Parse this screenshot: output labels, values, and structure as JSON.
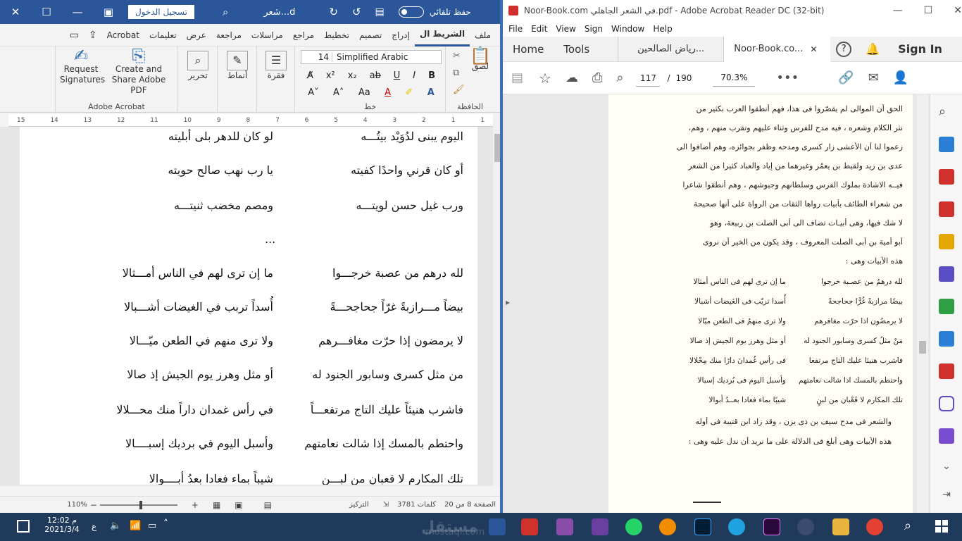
{
  "word": {
    "autosave_label": "حفظ تلقائي",
    "doc_name": "شعر...d",
    "signin_label": "تسجيل الدخول",
    "tabs": [
      "ملف",
      "الشريط ال",
      "إدراج",
      "تصميم",
      "تخطيط",
      "مراجع",
      "مراسلات",
      "مراجعة",
      "عرض",
      "تعليمات",
      "Acrobat"
    ],
    "groups": {
      "clipboard": "الحافظة",
      "paste": "لصق",
      "font": "خط",
      "paragraph": "فقرة",
      "styles": "أنماط",
      "editing": "تحرير",
      "acrobat_group": "Adobe Acrobat",
      "request_sigs": "Request Signatures",
      "create_share": "Create and Share Adobe PDF"
    },
    "font_name": "Simplified Arabic",
    "font_size": "14",
    "ruler_labels": [
      "15",
      "14",
      "13",
      "12",
      "11",
      "10",
      "9",
      "8",
      "7",
      "6",
      "5",
      "4",
      "3",
      "2",
      "1",
      "1"
    ],
    "verses": [
      {
        "h1": "اليوم يبنى لدُوَيْد بيتُـــه",
        "h2": "لو كان للدهر بلى أبليته"
      },
      {
        "h1": "أو كان قرني واحدًا كفيته",
        "h2": "يا رب نهب صالح حويته"
      },
      {
        "h1": "ورب غيل حسن لويتـــه",
        "h2": "ومصم مخضب ثنيتـــه"
      },
      {
        "h1": "...",
        "h2": ""
      },
      {
        "h1": "لله درهم من عصبة خرجـــوا",
        "h2": "ما إن ترى لهم في الناس أمـــثالا"
      },
      {
        "h1": "بيضاً مـــرازبةً غرّاً جحاجحـــةً",
        "h2": "أُسداً تربب في الغيضات أشـــبالا"
      },
      {
        "h1": "لا يرمضون إذا حرّت مغافـــرهم",
        "h2": "ولا ترى منهم في الطعن ميّـــالا"
      },
      {
        "h1": "من مثل كسرى وسابور الجنود له",
        "h2": "أو مثل وهرز يوم الجيش إذ صالا"
      },
      {
        "h1": "فاشرب هنيئاً عليك التاج مرتفعـــاً",
        "h2": "في رأس غمدان داراً منك محـــلالا"
      },
      {
        "h1": "واحتطم بالمسك إذا شالت نعامتهم",
        "h2": "وأسبل اليوم في برديك إسبــــالا"
      },
      {
        "h1": "تلك المكارم لا قعبان من لبـــن",
        "h2": "شيباً بماء فعادا بعدُ أبــــوالا"
      }
    ],
    "status": {
      "page": "الصفحة 8 من 20",
      "words": "3781 كلمات",
      "focus": "التركيز",
      "zoom": "110%"
    }
  },
  "acrobat": {
    "title": "Noor-Book.com في الشعر الجاهلي.pdf - Adobe Acrobat Reader DC (32-bit)",
    "menu": [
      "File",
      "Edit",
      "View",
      "Sign",
      "Window",
      "Help"
    ],
    "tabs": {
      "home": "Home",
      "tools": "Tools",
      "doc1": "رياض الصالحين...",
      "doc2": "Noor-Book.co..."
    },
    "signin": "Sign In",
    "page_current": "117",
    "page_sep": "/",
    "page_total": "190",
    "zoom": "70.3%",
    "page_lines": [
      "الحق أن الموالى لم يقصّروا فى هذا، فهم أنطقوا العرب بكثير من",
      "نثر الكلام وشعره ، فيه مدح للفرس وثناء عليهم وتقرب منهم ، وهم،",
      "زعموا لنا أن الأعشى زار كسرى ومدحه وظفر بجوائزه، وهم أضافوا الى",
      "عدى بن زيد ولقيط بن يعمُر وغيرهما من إياد والعباد كثيرا من الشعر",
      "فيــه الاشادة بملوك الفرس وسلطانهم وجيوشهم ، وهم أنطقوا شاعرا",
      "من شعراء الطائف بأبيات رواها الثقات من الرواة على أنها صحيحة",
      "لا شك فيها، وهى أبيـات تضاف الى أبى الصلت بن ربيعة، وهو",
      "أبو أمية بن أبى الصلت المعروف ، وقد يكون من الخير أن نروى",
      "هذه الأبيات وهى :"
    ],
    "poem": [
      {
        "r": "لله درهمُ من عصـبة خرجوا",
        "l": "ما إن ترى لهم فى الناس أمثالا"
      },
      {
        "r": "بيضًا مرازبةً غُرًّا جحاجحةً",
        "l": "أُسدا تربّب فى الغَيضات أشبالا"
      },
      {
        "r": "لا يرمضُون اذا حرّت مغافرهم",
        "l": "ولا ترى منهمُ فى الطعن ميّالا"
      },
      {
        "r": "مَنْ مثلُ كسرى وسابور الجنود له",
        "l": "أو مثل وهرز يوم الجيش إذ صالا"
      },
      {
        "r": "فاشرب هنيئا عليك التاج مرتفعا",
        "l": "فى رأس غُمدانَ دارًا منك مِحْلالا"
      },
      {
        "r": "واحتطم بالمسك اذا شالت نعامتهم",
        "l": "وأسبل اليوم فى بُرديك إسبالا"
      },
      {
        "r": "تلك المكارم لا قَعْبان من لبنٍ",
        "l": "شيبًا بماء فعادا بعــدُ أبوالا"
      }
    ],
    "after_lines": [
      "والشعر فى مدح سيف بن ذى يزن ، وقد زاد ابن قتيبة فى أوله",
      "هذه الأبيات وهى أبلغ فى الدلالة على ما نريد أن ندل عليه وهى :"
    ]
  },
  "taskbar": {
    "time": "12:02 م",
    "date": "2021/3/4",
    "lang": "ع",
    "watermark": "mostaql.com",
    "watermark_ar": "مستقل"
  },
  "colors": {
    "word_blue": "#2b579a",
    "acrobat_red": "#d0312d",
    "taskbar": "#203a5c"
  }
}
